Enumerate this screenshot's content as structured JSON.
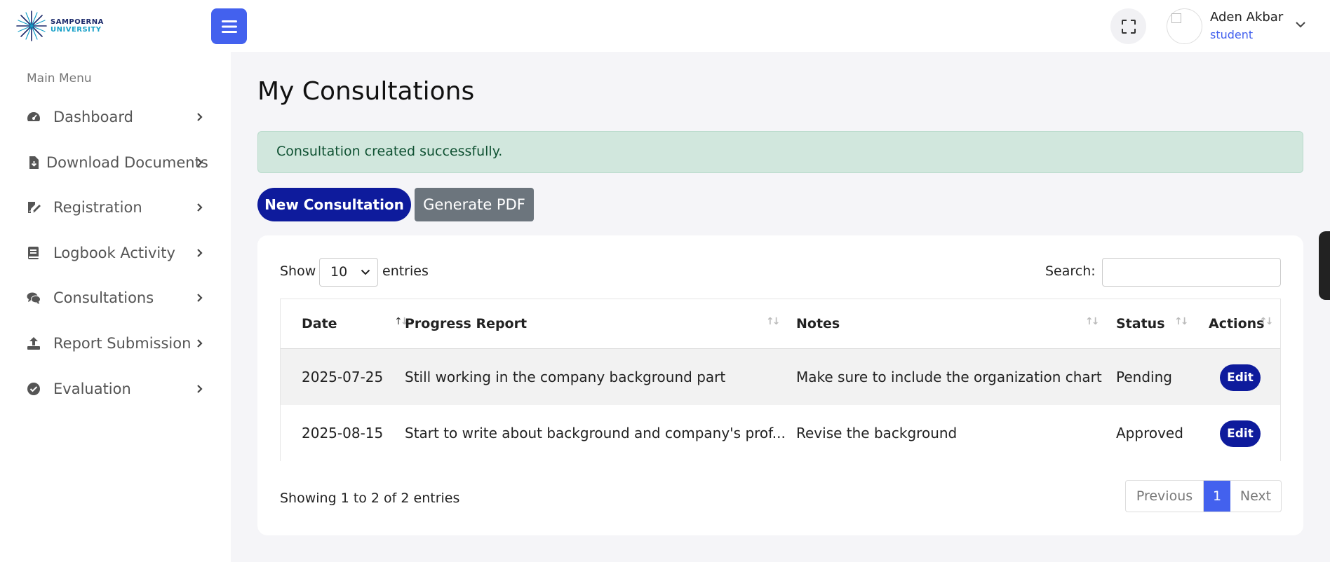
{
  "brand": {
    "line1": "SAMPOERNA",
    "line2": "UNIVERSITY"
  },
  "user": {
    "name": "Aden Akbar",
    "role": "student"
  },
  "sidebar": {
    "title": "Main Menu",
    "items": [
      {
        "label": "Dashboard",
        "icon": "gauge-icon"
      },
      {
        "label": "Download Documents",
        "icon": "file-download-icon"
      },
      {
        "label": "Registration",
        "icon": "signature-icon"
      },
      {
        "label": "Logbook Activity",
        "icon": "book-icon"
      },
      {
        "label": "Consultations",
        "icon": "comments-icon"
      },
      {
        "label": "Report Submission",
        "icon": "upload-icon"
      },
      {
        "label": "Evaluation",
        "icon": "check-circle-icon"
      }
    ]
  },
  "page": {
    "title": "My Consultations",
    "alert": "Consultation created successfully.",
    "new_button": "New Consultation",
    "pdf_button": "Generate PDF"
  },
  "table": {
    "show_label": "Show",
    "page_length": "10",
    "entries_label": "entries",
    "search_label": "Search:",
    "search_value": "",
    "columns": [
      "Date",
      "Progress Report",
      "Notes",
      "Status",
      "Actions"
    ],
    "rows": [
      {
        "date": "2025-07-25",
        "progress": "Still working in the company background part",
        "notes": "Make sure to include the organization chart",
        "status": "Pending",
        "action": "Edit"
      },
      {
        "date": "2025-08-15",
        "progress": "Start to write about background and company's prof...",
        "notes": "Revise the background",
        "status": "Approved",
        "action": "Edit"
      }
    ],
    "info": "Showing 1 to 2 of 2 entries",
    "pager": {
      "previous": "Previous",
      "current": "1",
      "next": "Next"
    }
  },
  "colors": {
    "primary": "#4361ee",
    "navy": "#0e1b9c",
    "alert_bg": "#d1e7dd",
    "alert_text": "#0f5132"
  }
}
